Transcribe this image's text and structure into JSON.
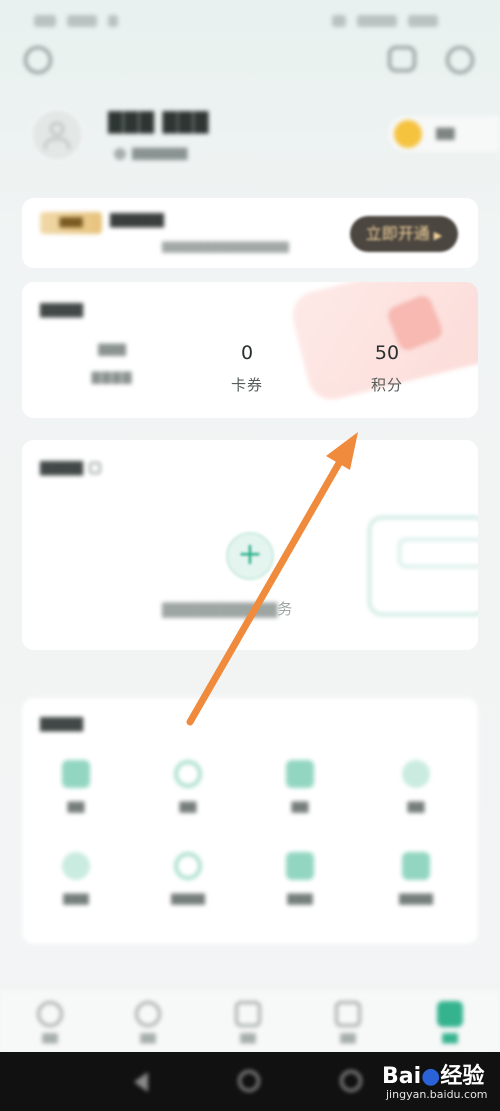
{
  "assets": {
    "title": "我的资产",
    "items": [
      {
        "value": "",
        "label": ""
      },
      {
        "value": "0",
        "label": "卡券"
      },
      {
        "value": "50",
        "label": "积分"
      }
    ]
  },
  "devices": {
    "hint_tail": "务"
  },
  "watermark": {
    "brand": "Bai",
    "brand_tail": "经验",
    "site": "jingyan.baidu.com"
  },
  "colors": {
    "accent_green": "#35b38f",
    "arrow_orange": "#f08a3c",
    "vip_button_bg": "#4c4640",
    "vip_button_text": "#f2d39c"
  },
  "annotation": {
    "type": "arrow",
    "color": "#f08a3c",
    "points_to": "assets-points"
  }
}
